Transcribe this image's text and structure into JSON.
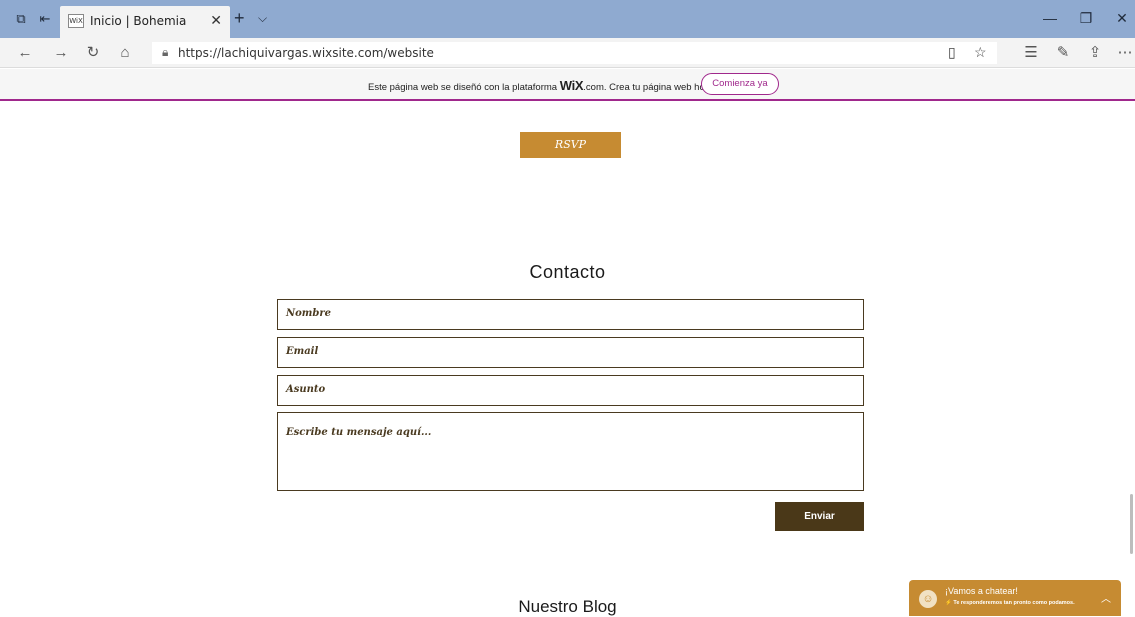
{
  "browser": {
    "tab_title": "Inicio | Bohemia",
    "favicon_text": "WiX",
    "url": "https://lachiquivargas.wixsite.com/website",
    "icons": {
      "tab_actions": "tabs-aside-icon",
      "back_tabs": "tabs-back-icon",
      "close_tab": "close-icon",
      "new_tab": "plus-icon",
      "tab_menu": "chevron-down-icon",
      "minimize": "minimize-icon",
      "restore": "restore-icon",
      "close_window": "close-icon",
      "back": "back-arrow-icon",
      "forward": "forward-arrow-icon",
      "refresh": "refresh-icon",
      "home": "home-icon",
      "lock": "lock-icon",
      "reading": "reading-view-icon",
      "favorite": "star-icon",
      "favorites": "favorites-list-icon",
      "notes": "pen-icon",
      "share": "share-icon",
      "more": "more-icon"
    }
  },
  "wix_banner": {
    "text_before": "Este página web se diseñó con la plataforma",
    "logo": "WiX",
    "text_after": ".com. Crea tu página web hoy.",
    "cta": "Comienza ya",
    "accent": "#a0288c"
  },
  "rsvp_label": "RSVP",
  "contact": {
    "title": "Contacto",
    "name_placeholder": "Nombre",
    "email_placeholder": "Email",
    "subject_placeholder": "Asunto",
    "message_placeholder": "Escribe tu mensaje aquí...",
    "send_label": "Enviar"
  },
  "blog_title": "Nuestro Blog",
  "chat": {
    "title": "¡Vamos a chatear!",
    "subtitle": "⚡ Te responderemos tan pronto como podamos."
  },
  "colors": {
    "tabbar": "#8faad0",
    "gold": "#c68b32",
    "dark_brown": "#4a3818"
  }
}
